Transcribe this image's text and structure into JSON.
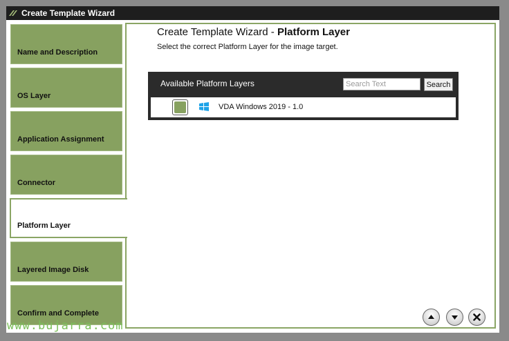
{
  "window": {
    "title": "Create Template Wizard"
  },
  "steps": [
    {
      "label": "Name and Description"
    },
    {
      "label": "OS Layer"
    },
    {
      "label": "Application Assignment"
    },
    {
      "label": "Connector"
    },
    {
      "label": "Platform Layer"
    },
    {
      "label": "Layered Image Disk"
    },
    {
      "label": "Confirm and Complete"
    }
  ],
  "active_step": "Platform Layer",
  "main": {
    "heading_prefix": "Create Template Wizard - ",
    "heading_strong": "Platform Layer",
    "subheading": "Select the correct Platform Layer for the image target."
  },
  "grid": {
    "title": "Available Platform Layers",
    "search_placeholder": "Search Text",
    "search_button": "Search",
    "rows": [
      {
        "label": "VDA Windows 2019 - 1.0",
        "icon": "windows-icon"
      }
    ]
  },
  "nav": {
    "up_icon": "arrow-up-icon",
    "down_icon": "arrow-down-icon",
    "close_icon": "close-icon"
  },
  "watermark": "www.bujarra.com",
  "colors": {
    "accent_green": "#87a160",
    "titlebar": "#1e1e1e",
    "grid_header": "#2b2b2b"
  }
}
